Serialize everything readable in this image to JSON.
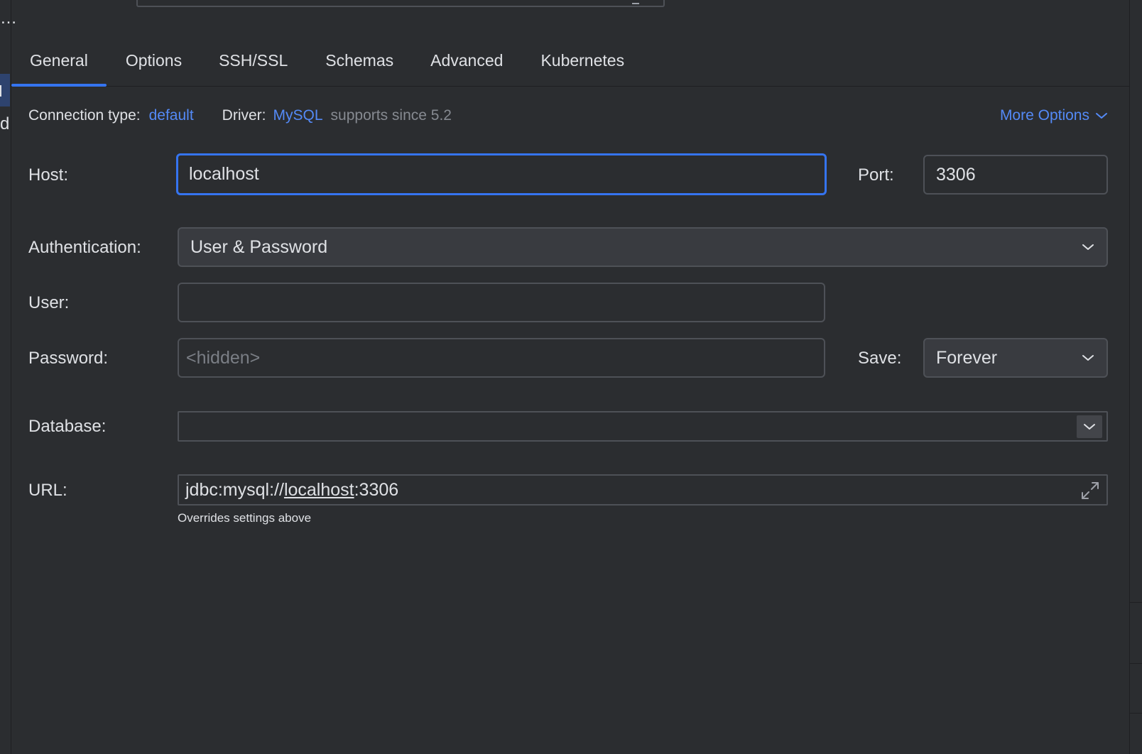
{
  "tabs": [
    {
      "label": "General",
      "active": true
    },
    {
      "label": "Options"
    },
    {
      "label": "SSH/SSL"
    },
    {
      "label": "Schemas"
    },
    {
      "label": "Advanced"
    },
    {
      "label": "Kubernetes"
    }
  ],
  "left_strip": {
    "dots": "…",
    "letter": "d"
  },
  "info": {
    "connection_type_label": "Connection type:",
    "connection_type_value": "default",
    "driver_label": "Driver:",
    "driver_value": "MySQL",
    "driver_note": "supports since 5.2",
    "more_options": "More Options"
  },
  "form": {
    "host_label": "Host:",
    "host_value": "localhost",
    "port_label": "Port:",
    "port_value": "3306",
    "auth_label": "Authentication:",
    "auth_value": "User & Password",
    "user_label": "User:",
    "user_value": "",
    "password_label": "Password:",
    "password_placeholder": "<hidden>",
    "save_label": "Save:",
    "save_value": "Forever",
    "database_label": "Database:",
    "database_value": "",
    "url_label": "URL:",
    "url_prefix": "jdbc:mysql://",
    "url_host": "localhost",
    "url_suffix": ":3306",
    "url_hint": "Overrides settings above"
  },
  "colors": {
    "background": "#2b2d30",
    "accent": "#3574f0",
    "link": "#548af7",
    "muted": "#868a91",
    "field_border": "#4e5157",
    "combo_bg": "#393b40"
  }
}
